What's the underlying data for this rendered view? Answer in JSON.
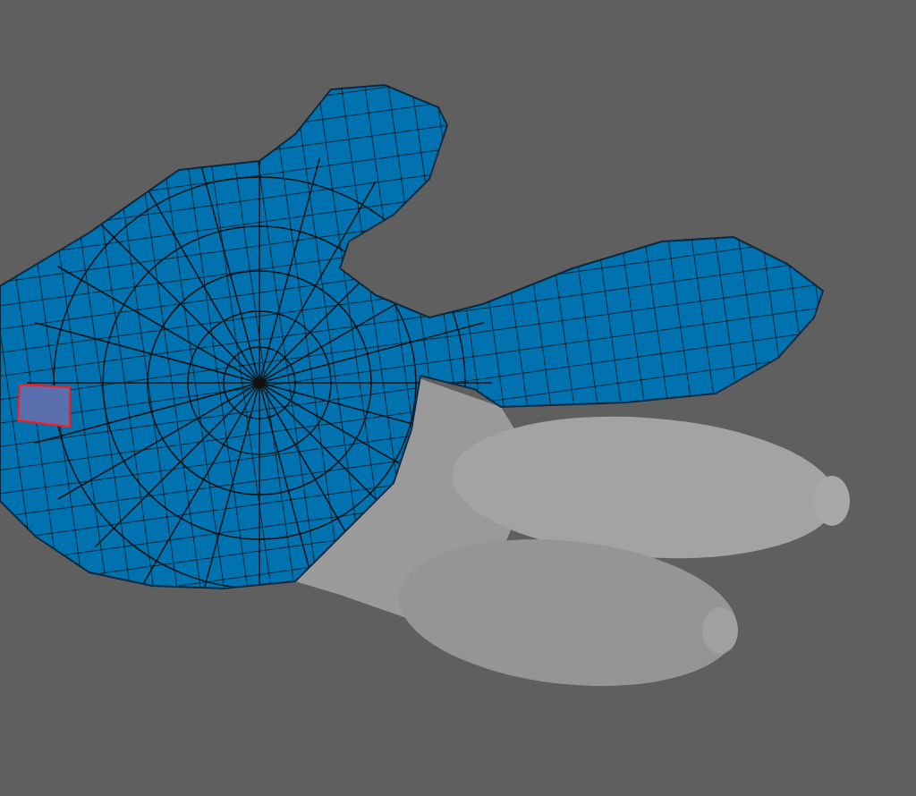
{
  "viewport": {
    "kind": "mesh",
    "highlighted_face": {
      "selected": true
    }
  }
}
